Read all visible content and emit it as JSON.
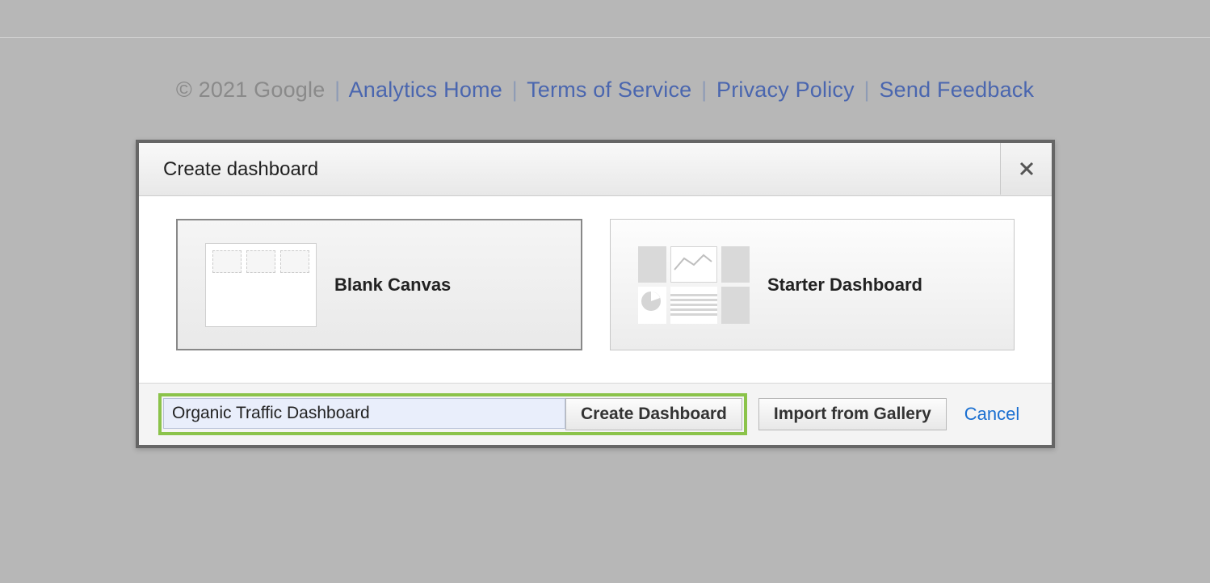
{
  "footer": {
    "copyright": "© 2021 Google",
    "links": {
      "home": "Analytics Home",
      "tos": "Terms of Service",
      "privacy": "Privacy Policy",
      "feedback": "Send Feedback"
    }
  },
  "dialog": {
    "title": "Create dashboard",
    "options": {
      "blank": "Blank Canvas",
      "starter": "Starter Dashboard"
    },
    "input_value": "Organic Traffic Dashboard",
    "create_btn": "Create Dashboard",
    "import_btn": "Import from Gallery",
    "cancel": "Cancel"
  }
}
